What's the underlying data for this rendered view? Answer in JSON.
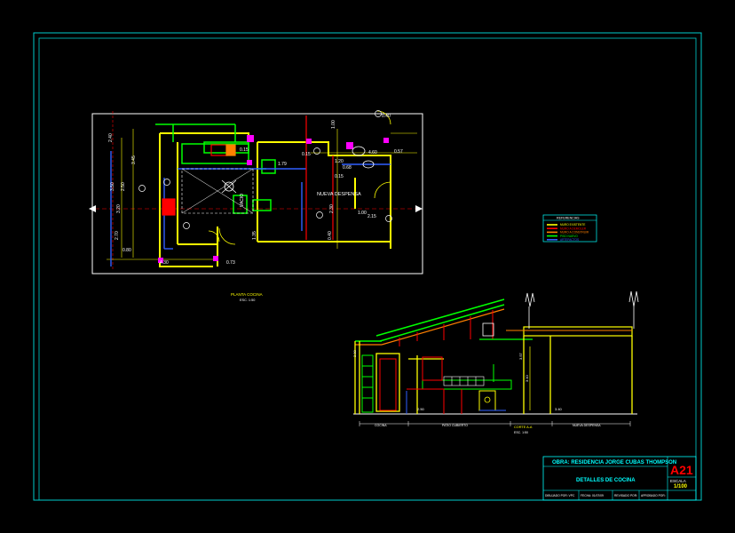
{
  "colors": {
    "background": "#000000",
    "frame": "#00ffff",
    "wall": "#ffff00",
    "accent_red": "#ff0000",
    "accent_green": "#00ff00",
    "accent_magenta": "#ff00ff",
    "accent_blue": "#3060ff",
    "accent_orange": "#ff8000",
    "dim_white": "#ffffff",
    "title_fill": "#ff0000"
  },
  "plan": {
    "dimensions": [
      "4.30",
      "0.80",
      "2.50",
      "1.79",
      "3.45",
      "0.15",
      "2.30",
      "1.20",
      "0.15",
      "0.73",
      "4.60",
      "1.00",
      "2.15",
      "0.68",
      "0.15",
      "0.57",
      "0.40",
      "1.00",
      "3.20",
      "2.70",
      "1.35",
      "3.50",
      "0.40",
      "2.40"
    ],
    "room_label": "NUEVA DESPENSA",
    "hall_label": "VACIO",
    "caption_title": "PLANTA COCINA",
    "caption_scale": "ESC. 1:50"
  },
  "section": {
    "dimensions": [
      "3.10",
      "3.57",
      "2.90",
      "2.50",
      "3.40"
    ],
    "label_left": "COCINA",
    "label_mid": "PATIO CUBIERTO",
    "label_right": "NUEVA DESPENSA",
    "cut_label": "CORTE A-A",
    "cut_scale": "ESC. 1:50"
  },
  "legend": {
    "title": "REFERENCIAS",
    "items": [
      {
        "label": "MURO EXISTENTE",
        "color": "#ffff00"
      },
      {
        "label": "MURO A DEMOLER",
        "color": "#ff0000"
      },
      {
        "label": "MURO A CONSTRUIR",
        "color": "#ff8000"
      },
      {
        "label": "PISO NUEVO",
        "color": "#00ff00"
      },
      {
        "label": "ARTEFACTOS",
        "color": "#3060ff"
      }
    ]
  },
  "title_block": {
    "project": "OBRA: RESIDENCIA JORGE CUBAS THOMPSON",
    "sheet_title": "DETALLES DE COCINA",
    "sheet_number": "A21",
    "scale_label": "ESCALA",
    "scale_value": "1/100",
    "footer_1": "DIBUJADO POR: VPC",
    "footer_2": "FECHA: 01/07/09",
    "footer_3": "REVISADO POR:",
    "footer_4": "APROBADO POR:"
  }
}
